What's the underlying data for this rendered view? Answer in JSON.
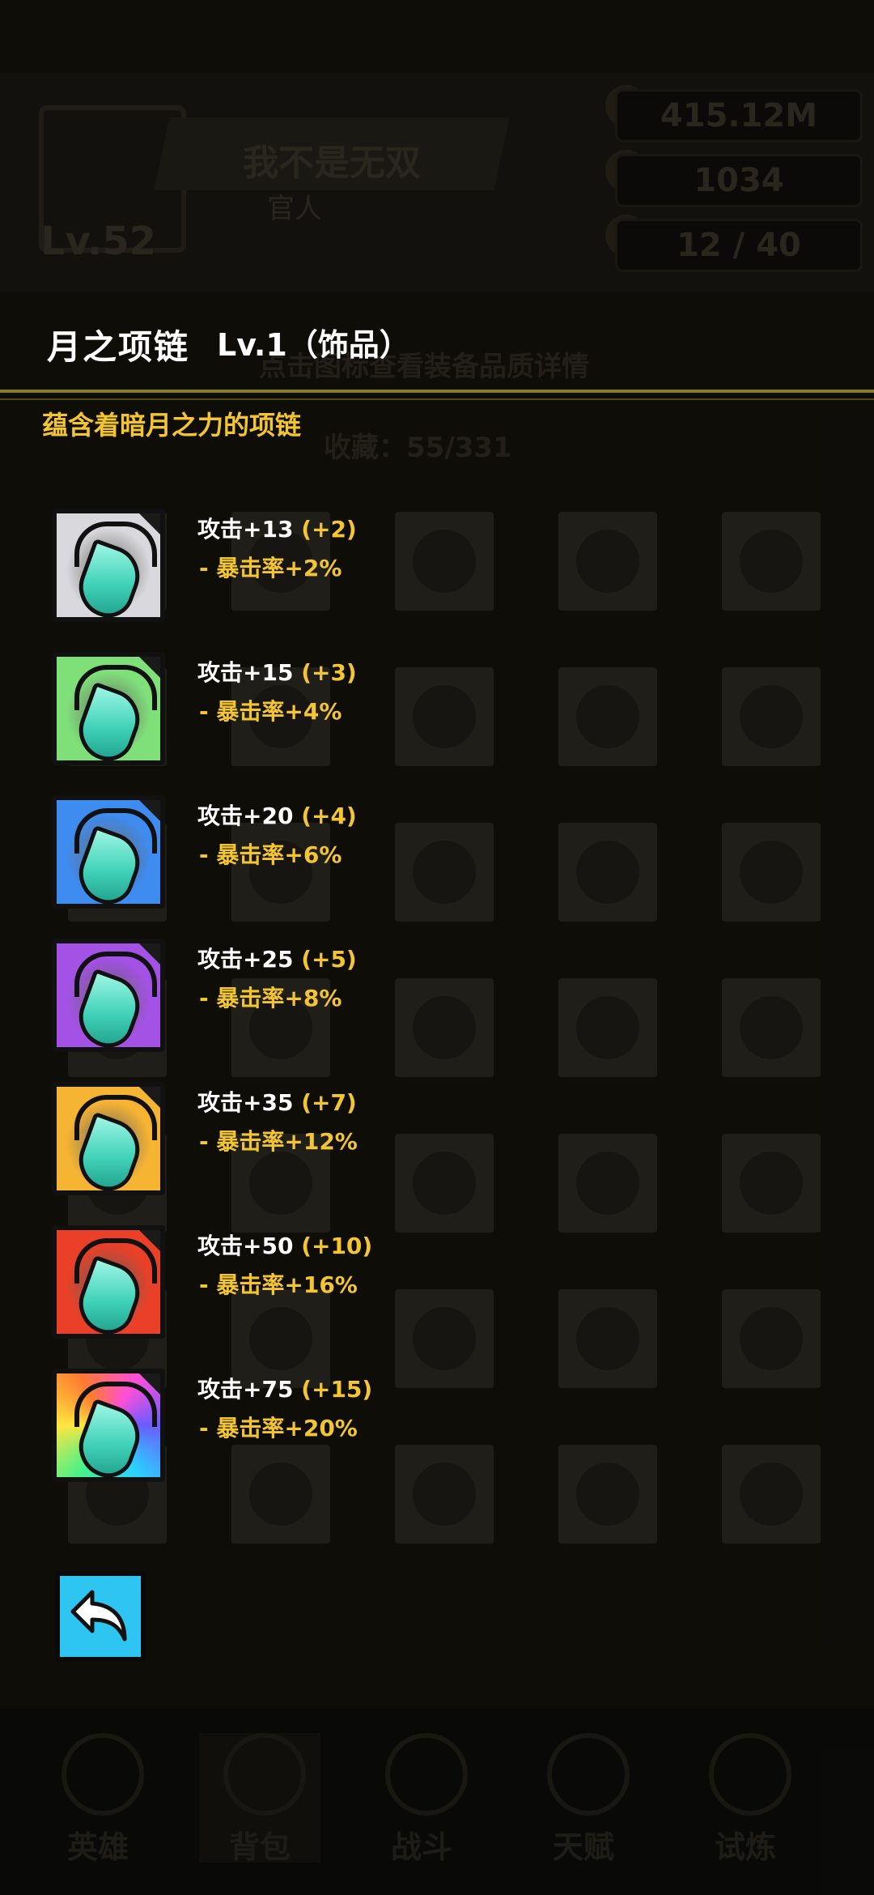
{
  "background": {
    "player_name": "我不是无双",
    "player_sub": "官人",
    "player_level": "Lv.52",
    "resources": [
      "415.12M",
      "1034",
      "12 / 40"
    ],
    "hint": "点击图标查看装备品质详情",
    "slot_count": "收藏：55/331",
    "tabs": [
      "英雄",
      "背包",
      "战斗",
      "天赋",
      "试炼"
    ]
  },
  "item": {
    "name": "月之项链",
    "level": "Lv.1（饰品）",
    "description": "蕴含着暗月之力的项链"
  },
  "tiers": [
    {
      "attack": "攻击+13",
      "bonus": "(+2)",
      "crit": "- 暴击率+2%",
      "color": "#d9d9dd"
    },
    {
      "attack": "攻击+15",
      "bonus": "(+3)",
      "crit": "- 暴击率+4%",
      "color": "#7fe07a"
    },
    {
      "attack": "攻击+20",
      "bonus": "(+4)",
      "crit": "- 暴击率+6%",
      "color": "#3f8cf0"
    },
    {
      "attack": "攻击+25",
      "bonus": "(+5)",
      "crit": "- 暴击率+8%",
      "color": "#a451e6"
    },
    {
      "attack": "攻击+35",
      "bonus": "(+7)",
      "crit": "- 暴击率+12%",
      "color": "#f6b433"
    },
    {
      "attack": "攻击+50",
      "bonus": "(+10)",
      "crit": "- 暴击率+16%",
      "color": "#ea4027"
    },
    {
      "attack": "攻击+75",
      "bonus": "(+15)",
      "crit": "- 暴击率+20%",
      "color": "rainbow"
    }
  ],
  "icons": {
    "tier_icon": "moon-necklace-icon",
    "back": "back-arrow-icon"
  }
}
